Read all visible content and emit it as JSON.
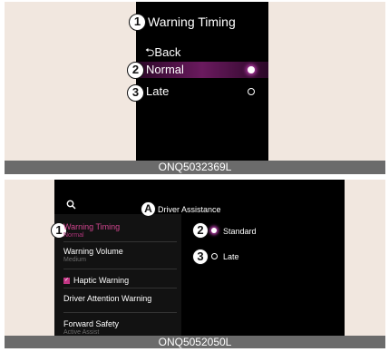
{
  "panel1": {
    "callouts": {
      "title": "1",
      "normal": "2",
      "late": "3"
    },
    "title": "Warning Timing",
    "back_label": "Back",
    "options": [
      {
        "label": "Normal",
        "selected": true
      },
      {
        "label": "Late",
        "selected": false
      }
    ],
    "caption": "ONQ5032369L"
  },
  "panel2": {
    "callouts": {
      "header": "A",
      "warning_timing": "1",
      "standard": "2",
      "late": "3"
    },
    "header": "Driver Assistance",
    "menu": {
      "warning_timing": {
        "title": "Warning Timing",
        "value": "Normal"
      },
      "warning_volume": {
        "title": "Warning Volume",
        "value": "Medium"
      },
      "haptic_warning": {
        "title": "Haptic Warning",
        "checked": true
      },
      "driver_attention": {
        "title": "Driver Attention Warning"
      },
      "forward_safety": {
        "title": "Forward Safety",
        "value": "Active Assist"
      }
    },
    "options": [
      {
        "label": "Standard",
        "selected": true
      },
      {
        "label": "Late",
        "selected": false
      }
    ],
    "caption": "ONQ5052050L"
  },
  "colors": {
    "accent": "#c23584",
    "screen": "#000000",
    "page": "#f1e7df",
    "caption_bar": "#6b6b6b"
  }
}
